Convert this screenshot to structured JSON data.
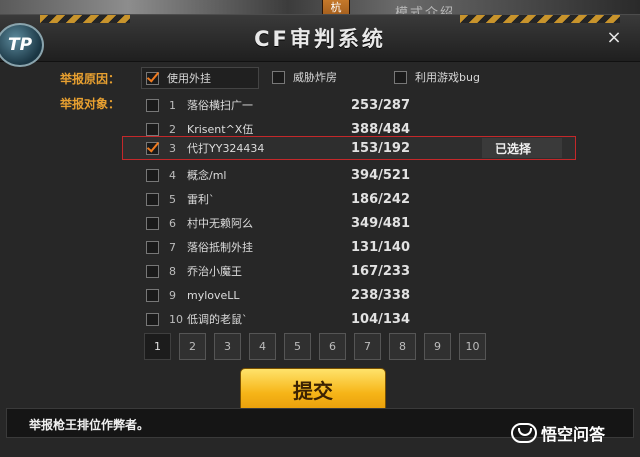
{
  "background": {
    "tab_text": "杭",
    "right_label": "模式介绍"
  },
  "window": {
    "title": "CF审判系统",
    "logo_text": "TP",
    "close_symbol": "×"
  },
  "report_reason": {
    "label": "举报原因：",
    "options": [
      {
        "label": "使用外挂",
        "checked": true
      },
      {
        "label": "威胁炸房",
        "checked": false
      },
      {
        "label": "利用游戏bug",
        "checked": false
      }
    ]
  },
  "report_target": {
    "label": "举报对象：",
    "selected_text": "已选择",
    "rows": [
      {
        "index": "1",
        "name": "落俗横扫广一",
        "score": "253/287",
        "checked": false
      },
      {
        "index": "2",
        "name": "Krisent^X伍",
        "score": "388/484",
        "checked": false
      },
      {
        "index": "3",
        "name": "代打YY324434",
        "score": "153/192",
        "checked": true
      },
      {
        "index": "4",
        "name": "概念/ml",
        "score": "394/521",
        "checked": false
      },
      {
        "index": "5",
        "name": "雷利`",
        "score": "186/242",
        "checked": false
      },
      {
        "index": "6",
        "name": "村中无赖阿么",
        "score": "349/481",
        "checked": false
      },
      {
        "index": "7",
        "name": "落俗抵制外挂",
        "score": "131/140",
        "checked": false
      },
      {
        "index": "8",
        "name": "乔治小魔王",
        "score": "167/233",
        "checked": false
      },
      {
        "index": "9",
        "name": "myloveLL",
        "score": "238/338",
        "checked": false
      },
      {
        "index": "10",
        "name": "低调的老鼠`",
        "score": "104/134",
        "checked": false
      }
    ]
  },
  "pagination": {
    "pages": [
      "1",
      "2",
      "3",
      "4",
      "5",
      "6",
      "7",
      "8",
      "9",
      "10"
    ],
    "active": "1"
  },
  "submit_label": "提交",
  "footer_text": "举报枪王排位作弊者。",
  "watermark_text": "悟空问答",
  "colors": {
    "accent_orange": "#e8a030",
    "selected_border": "#c4282a",
    "submit_yellow": "#f6b518"
  }
}
